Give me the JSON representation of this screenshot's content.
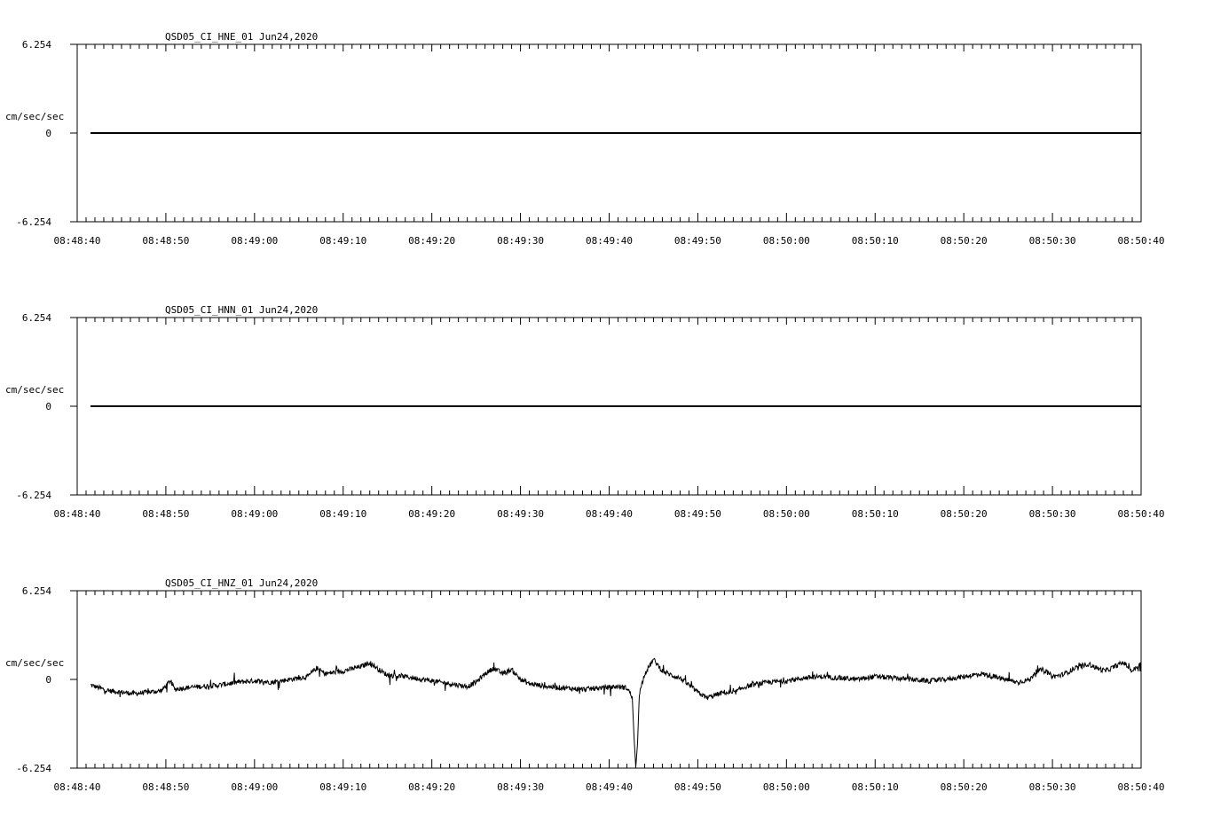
{
  "chart_data": [
    {
      "type": "line",
      "title": "QSD05_CI_HNE_01  Jun24,2020",
      "ylabel": "cm/sec/sec",
      "ylim": [
        -6.254,
        6.254
      ],
      "yticks": [
        "6.254",
        "0",
        "-6.254"
      ],
      "xticks": [
        "08:48:40",
        "08:48:50",
        "08:49:00",
        "08:49:10",
        "08:49:20",
        "08:49:30",
        "08:49:40",
        "08:49:50",
        "08:50:00",
        "08:50:10",
        "08:50:20",
        "08:50:30",
        "08:50:40"
      ],
      "series": [
        {
          "x_start_sec": 1.5,
          "x_end_sec": 120,
          "values": [
            0,
            0
          ]
        }
      ]
    },
    {
      "type": "line",
      "title": "QSD05_CI_HNN_01  Jun24,2020",
      "ylabel": "cm/sec/sec",
      "ylim": [
        -6.254,
        6.254
      ],
      "yticks": [
        "6.254",
        "0",
        "-6.254"
      ],
      "xticks": [
        "08:48:40",
        "08:48:50",
        "08:49:00",
        "08:49:10",
        "08:49:20",
        "08:49:30",
        "08:49:40",
        "08:49:50",
        "08:50:00",
        "08:50:10",
        "08:50:20",
        "08:50:30",
        "08:50:40"
      ],
      "series": [
        {
          "x_start_sec": 1.5,
          "x_end_sec": 120,
          "values": [
            0,
            0
          ]
        }
      ]
    },
    {
      "type": "line",
      "title": "QSD05_CI_HNZ_01  Jun24,2020",
      "ylabel": "cm/sec/sec",
      "ylim": [
        -6.254,
        6.254
      ],
      "yticks": [
        "6.254",
        "0",
        "-6.254"
      ],
      "xticks": [
        "08:48:40",
        "08:48:50",
        "08:49:00",
        "08:49:10",
        "08:49:20",
        "08:49:30",
        "08:49:40",
        "08:49:50",
        "08:50:00",
        "08:50:10",
        "08:50:20",
        "08:50:30",
        "08:50:40"
      ],
      "series": [
        {
          "x_start_sec": 1.5,
          "x_end_sec": 120,
          "points": [
            [
              1.5,
              -0.4
            ],
            [
              2.5,
              -0.6
            ],
            [
              3.5,
              -0.8
            ],
            [
              5,
              -0.9
            ],
            [
              6.5,
              -1.0
            ],
            [
              8,
              -0.9
            ],
            [
              9.5,
              -0.8
            ],
            [
              10.5,
              -0.1
            ],
            [
              11,
              -0.7
            ],
            [
              12,
              -0.6
            ],
            [
              14,
              -0.5
            ],
            [
              16,
              -0.4
            ],
            [
              18,
              -0.2
            ],
            [
              20,
              -0.1
            ],
            [
              22,
              -0.2
            ],
            [
              24,
              0.0
            ],
            [
              26,
              0.2
            ],
            [
              27,
              0.8
            ],
            [
              28,
              0.4
            ],
            [
              30,
              0.6
            ],
            [
              32,
              0.9
            ],
            [
              33,
              1.2
            ],
            [
              34,
              0.7
            ],
            [
              35,
              0.3
            ],
            [
              37,
              0.2
            ],
            [
              39,
              0.0
            ],
            [
              41,
              -0.2
            ],
            [
              43,
              -0.4
            ],
            [
              44,
              -0.5
            ],
            [
              45,
              -0.2
            ],
            [
              46,
              0.4
            ],
            [
              47,
              0.8
            ],
            [
              48,
              0.4
            ],
            [
              49,
              0.7
            ],
            [
              50,
              0.0
            ],
            [
              51,
              -0.3
            ],
            [
              53,
              -0.5
            ],
            [
              55,
              -0.6
            ],
            [
              57,
              -0.7
            ],
            [
              59,
              -0.6
            ],
            [
              61,
              -0.5
            ],
            [
              62,
              -0.6
            ],
            [
              62.6,
              -1.2
            ],
            [
              62.8,
              -4.0
            ],
            [
              63,
              -6.2
            ],
            [
              63.2,
              -4.5
            ],
            [
              63.4,
              -1.0
            ],
            [
              64,
              0.4
            ],
            [
              65,
              1.4
            ],
            [
              66,
              0.6
            ],
            [
              67,
              0.3
            ],
            [
              68,
              0.1
            ],
            [
              69,
              -0.4
            ],
            [
              70,
              -0.9
            ],
            [
              71,
              -1.3
            ],
            [
              72,
              -1.1
            ],
            [
              73,
              -0.9
            ],
            [
              74,
              -1.0
            ],
            [
              75,
              -0.6
            ],
            [
              76,
              -0.4
            ],
            [
              78,
              -0.2
            ],
            [
              80,
              -0.1
            ],
            [
              82,
              0.1
            ],
            [
              84,
              0.2
            ],
            [
              86,
              0.1
            ],
            [
              88,
              0.0
            ],
            [
              90,
              0.2
            ],
            [
              92,
              0.1
            ],
            [
              94,
              0.0
            ],
            [
              96,
              -0.1
            ],
            [
              98,
              0.0
            ],
            [
              100,
              0.2
            ],
            [
              102,
              0.4
            ],
            [
              104,
              0.1
            ],
            [
              106,
              -0.2
            ],
            [
              107.5,
              0.0
            ],
            [
              108,
              0.5
            ],
            [
              109,
              0.7
            ],
            [
              110,
              0.2
            ],
            [
              111,
              0.3
            ],
            [
              112,
              0.6
            ],
            [
              113,
              0.9
            ],
            [
              114,
              1.1
            ],
            [
              115,
              0.8
            ],
            [
              116,
              0.6
            ],
            [
              117,
              0.9
            ],
            [
              118,
              1.2
            ],
            [
              119,
              0.6
            ],
            [
              120,
              1.1
            ]
          ]
        }
      ]
    }
  ]
}
